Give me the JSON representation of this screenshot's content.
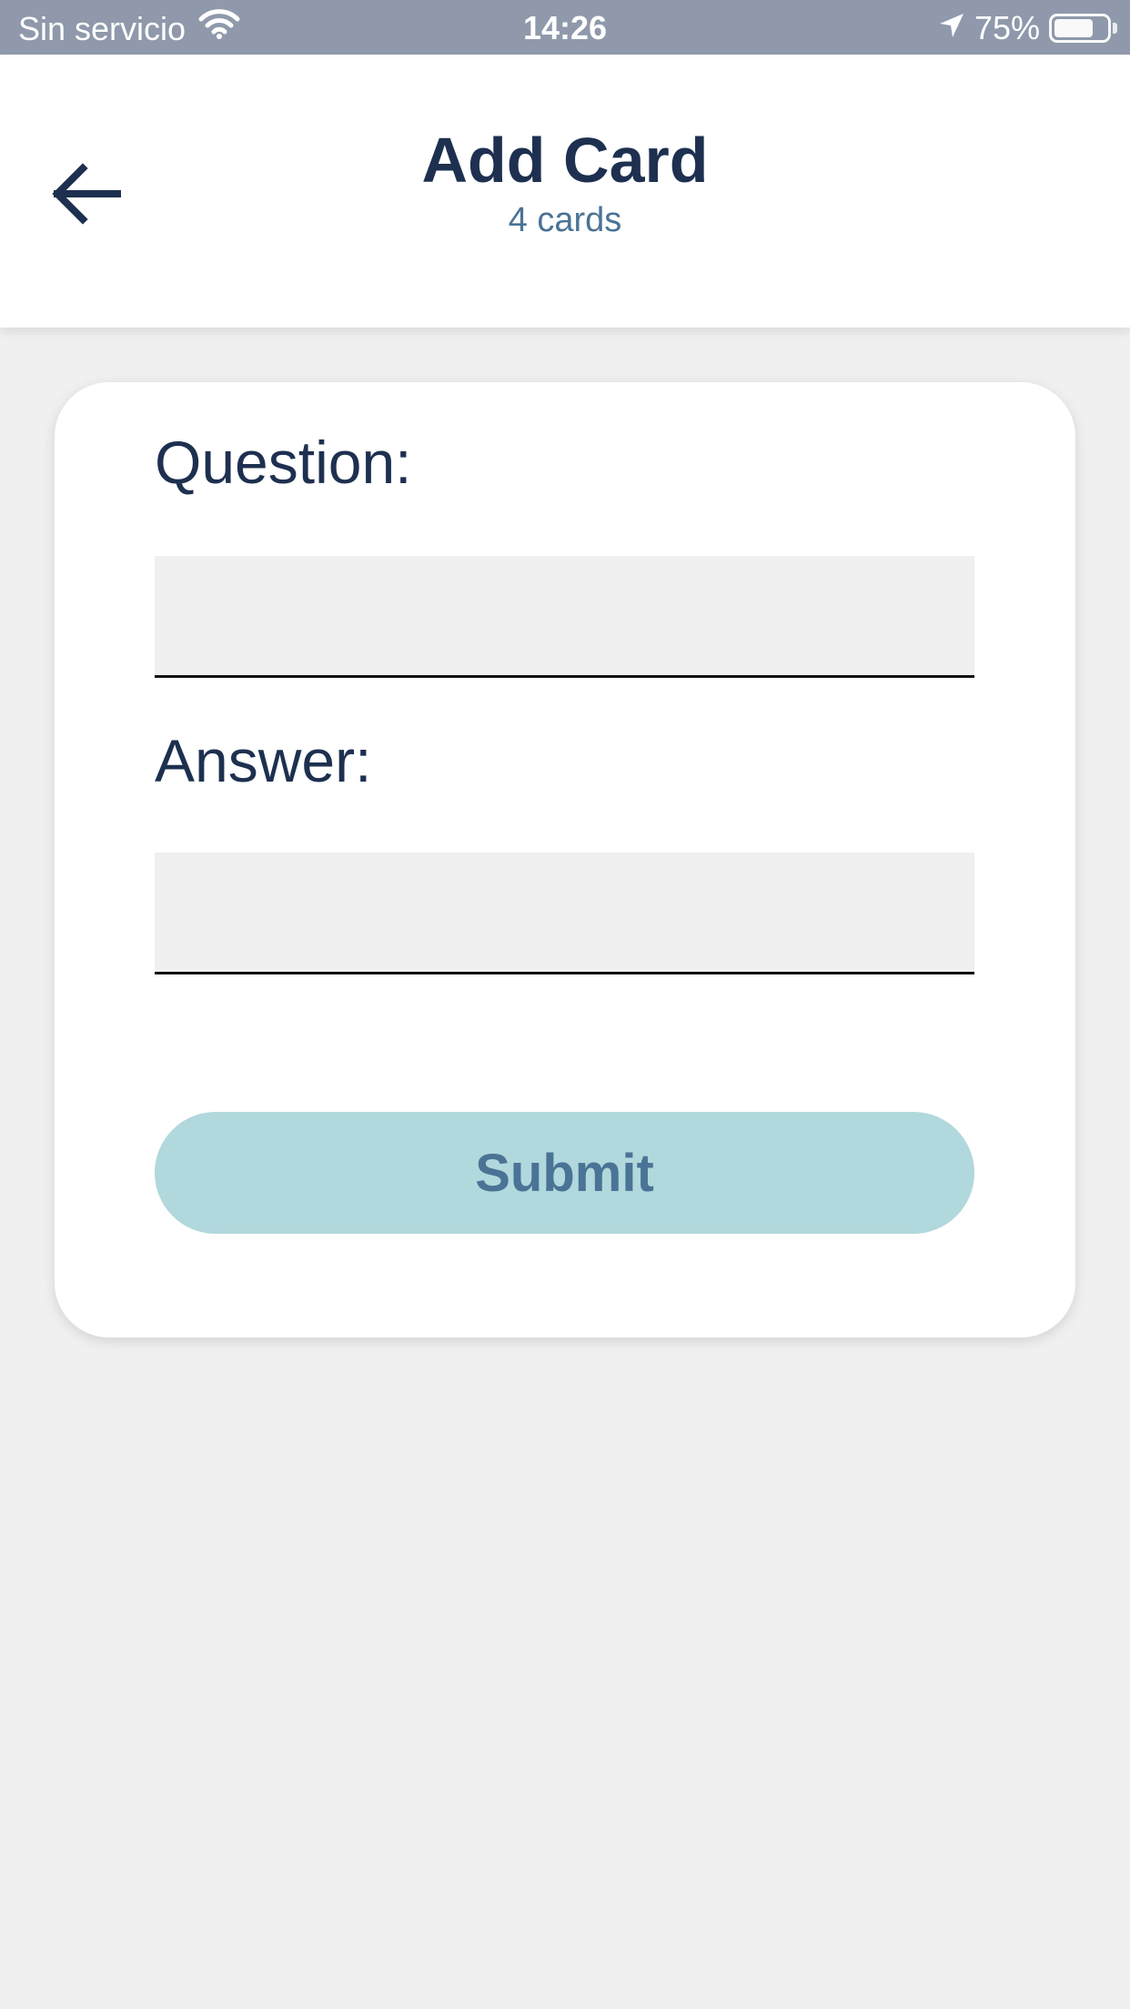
{
  "status_bar": {
    "carrier": "Sin servicio",
    "time": "14:26",
    "battery": "75%",
    "battery_level": 0.75
  },
  "header": {
    "title": "Add Card",
    "subtitle": "4 cards"
  },
  "form": {
    "question_label": "Question:",
    "question_value": "",
    "answer_label": "Answer:",
    "answer_value": "",
    "submit_label": "Submit"
  },
  "colors": {
    "status_bar_bg": "#8f99ab",
    "title": "#1e3050",
    "subtitle": "#4a7396",
    "background": "#f0f0f0",
    "submit_bg": "#b1d8dc",
    "submit_text": "#4a7396"
  }
}
